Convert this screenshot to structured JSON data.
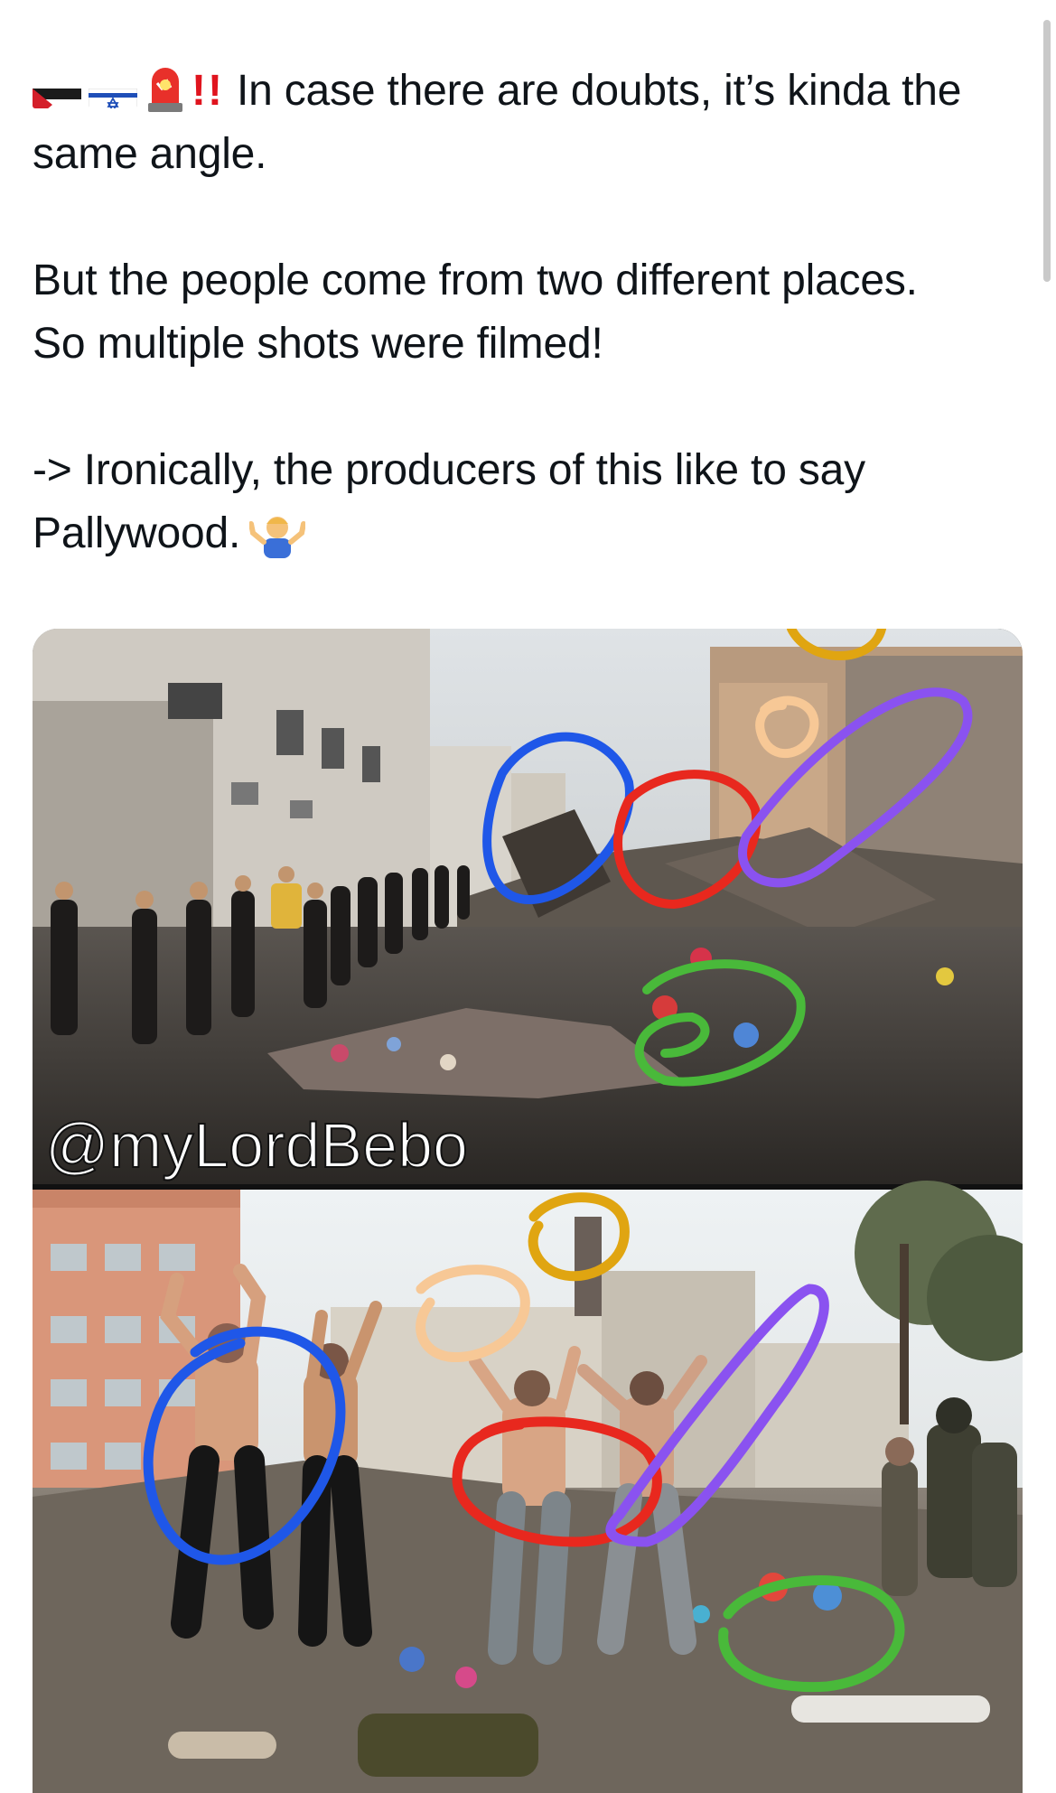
{
  "post": {
    "emoji": [
      "palestine-flag",
      "israel-flag",
      "siren",
      "double-exclamation"
    ],
    "bangbang": "!!",
    "line1": "In case there are doubts, it’s kinda the same angle.",
    "line2a": "But the people come from two different places.",
    "line2b": "So multiple shots were filmed!",
    "line3": "-> Ironically, the producers of this like to say Pallywood.",
    "trailing_emoji": "person-shrugging"
  },
  "media": {
    "watermark": "@myLordBebo",
    "annotation_colors": {
      "blue": "#1f57e8",
      "red": "#e8281e",
      "purple": "#8a52f0",
      "green": "#49b93a",
      "gold": "#e0a511",
      "peach": "#f7c896"
    }
  }
}
